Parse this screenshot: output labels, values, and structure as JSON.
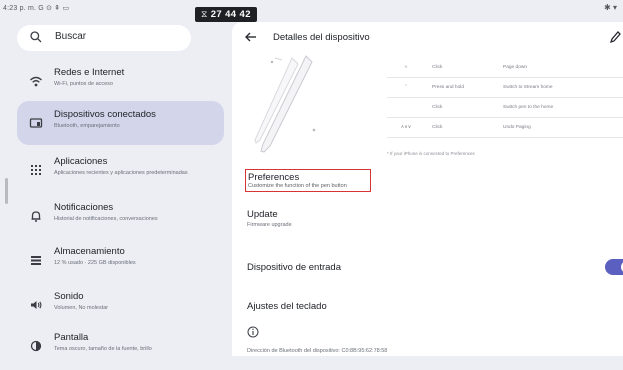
{
  "status_bar": {
    "time": "4:23 p. m.",
    "indicators": "G ⊙ ⇞ ▭",
    "timer": "27 44 42",
    "right_icons": "✱ ▾"
  },
  "search": {
    "label": "Buscar"
  },
  "nav": [
    {
      "title": "Redes e Internet",
      "sub": "Wi-Fi, puntos de acceso",
      "icon": "wifi-icon"
    },
    {
      "title": "Dispositivos conectados",
      "sub": "Bluetooth, emparejamiento",
      "icon": "devices-icon",
      "selected": true
    },
    {
      "title": "Aplicaciones",
      "sub": "Aplicaciones recientes y aplicaciones predeterminadas",
      "icon": "apps-grid-icon"
    },
    {
      "title": "Notificaciones",
      "sub": "Historial de notificaciones, conversaciones",
      "icon": "bell-icon"
    },
    {
      "title": "Almacenamiento",
      "sub": "12 % usado · 225 GB disponibles",
      "icon": "storage-icon"
    },
    {
      "title": "Sonido",
      "sub": "Volumen, No molestar",
      "icon": "speaker-icon"
    },
    {
      "title": "Pantalla",
      "sub": "Tema oscuro, tamaño de la fuente, brillo",
      "icon": "brightness-icon"
    }
  ],
  "detail": {
    "title": "Detalles del dispositivo",
    "gestures": [
      {
        "icon": "≈",
        "action": "Click",
        "result": "Page down"
      },
      {
        "icon": "",
        "action": "Press and hold",
        "result": "Switch to Stream home"
      },
      {
        "icon": "",
        "action": "Click",
        "result": "Switch pen to the home"
      },
      {
        "icon": "∧∨∨",
        "action": "Click",
        "result": "Undo Paging"
      }
    ],
    "table_note": "* If your iPhone is connected to Preferences",
    "preferences": {
      "title": "Preferences",
      "sub": "Customize the function of the pen button"
    },
    "update": {
      "title": "Update",
      "sub": "Firmware upgrade"
    },
    "input_device": {
      "label": "Dispositivo de entrada",
      "enabled": true
    },
    "keyboard_settings": {
      "label": "Ajustes del teclado"
    },
    "bt_address": "Dirección de Bluetooth del dispositivo: C0:8B:95:62:78:58"
  },
  "colors": {
    "accent": "#5b5fc0",
    "highlight_box": "#d53535",
    "selected_bg": "#d3d6ea"
  }
}
